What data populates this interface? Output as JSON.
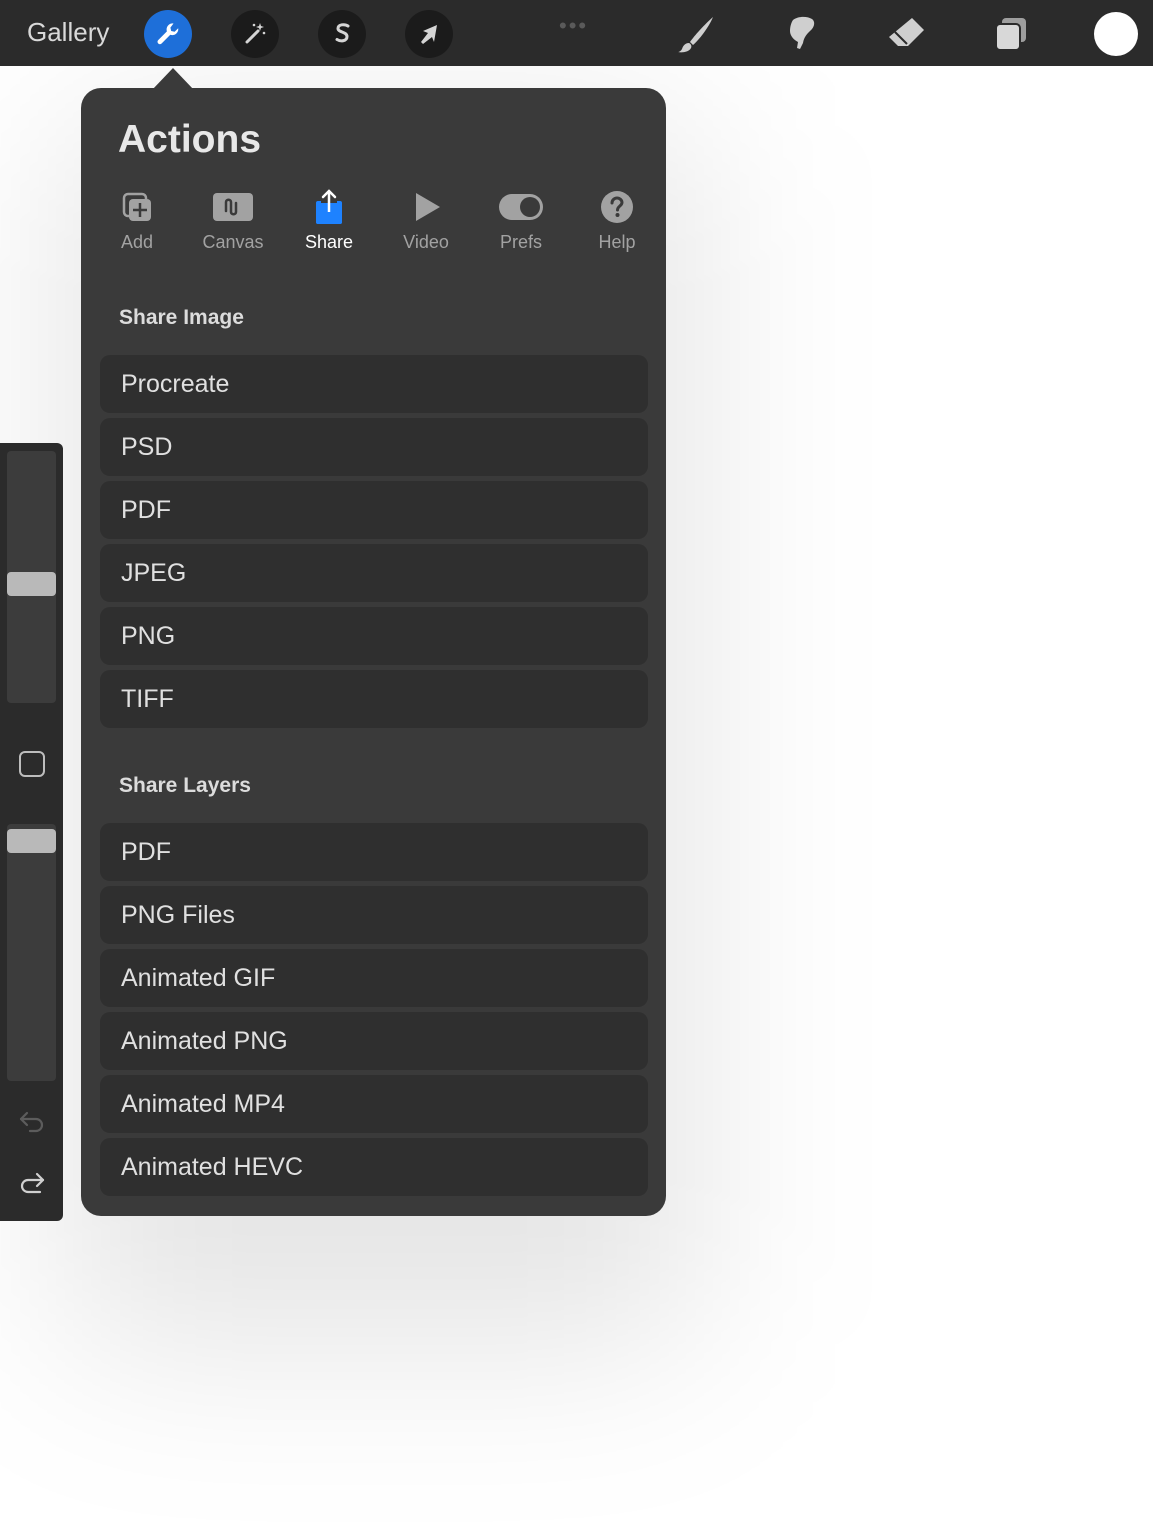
{
  "toolbar": {
    "gallery_label": "Gallery",
    "left_tools": [
      {
        "name": "actions",
        "icon": "wrench-icon",
        "active": true
      },
      {
        "name": "adjustments",
        "icon": "magic-wand-icon",
        "active": false
      },
      {
        "name": "selection",
        "icon": "selection-s-icon",
        "active": false
      },
      {
        "name": "transform",
        "icon": "arrow-cursor-icon",
        "active": false
      }
    ],
    "right_tools": [
      "brush-icon",
      "smudge-icon",
      "eraser-icon",
      "layers-icon",
      "color-icon"
    ],
    "colors": {
      "active_tool": "#1e6fd9",
      "current_color": "#ffffff"
    }
  },
  "popover": {
    "title": "Actions",
    "tabs": [
      {
        "label": "Add",
        "icon": "add-icon"
      },
      {
        "label": "Canvas",
        "icon": "canvas-icon"
      },
      {
        "label": "Share",
        "icon": "share-icon",
        "active": true
      },
      {
        "label": "Video",
        "icon": "video-icon"
      },
      {
        "label": "Prefs",
        "icon": "toggle-icon"
      },
      {
        "label": "Help",
        "icon": "help-icon"
      }
    ],
    "share_image": {
      "title": "Share Image",
      "items": [
        "Procreate",
        "PSD",
        "PDF",
        "JPEG",
        "PNG",
        "TIFF"
      ]
    },
    "share_layers": {
      "title": "Share Layers",
      "items": [
        "PDF",
        "PNG Files",
        "Animated GIF",
        "Animated PNG",
        "Animated MP4",
        "Animated HEVC"
      ]
    }
  },
  "sidebar": {
    "brush_size_level": 0.5,
    "opacity_level": 0.95,
    "icons": [
      "modify-square-icon",
      "undo-icon",
      "redo-icon"
    ]
  }
}
